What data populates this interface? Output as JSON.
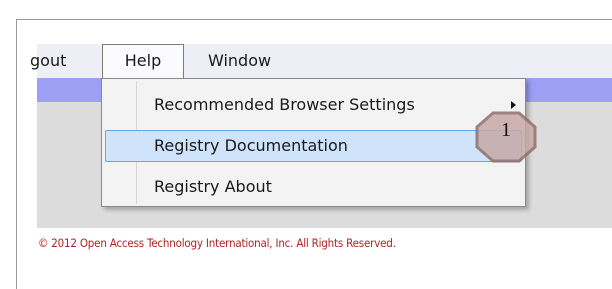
{
  "menubar": {
    "items": [
      {
        "label": "gout"
      },
      {
        "label": "Help"
      },
      {
        "label": "Window"
      }
    ]
  },
  "help_menu": {
    "items": [
      {
        "label": "Recommended Browser Settings",
        "has_submenu": true
      },
      {
        "label": "Registry Documentation",
        "highlighted": true
      },
      {
        "label": "Registry About"
      }
    ]
  },
  "callout": {
    "label": "1"
  },
  "footer": {
    "copyright": "© 2012 Open Access Technology International, Inc. All Rights Reserved."
  },
  "colors": {
    "menubar_bg": "#eeeff6",
    "blue_band": "#9d9ff4",
    "content_gray": "#dcdcdc",
    "highlight": "#cfe3fb",
    "callout_fill": "#c7a9a7",
    "copyright_text": "#b22222"
  }
}
